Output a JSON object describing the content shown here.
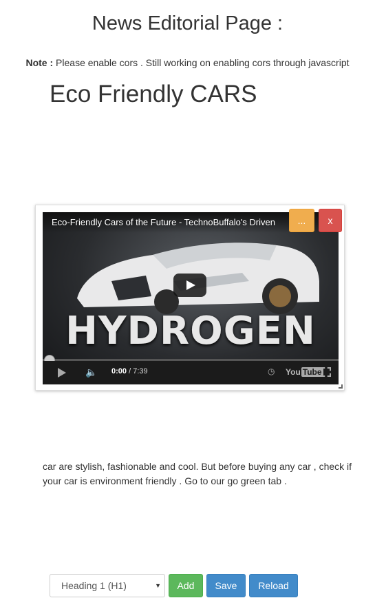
{
  "page": {
    "title": "News Editorial Page :",
    "note_label": "Note :",
    "note_text": " Please enable cors . Still working on enabling cors through javascript"
  },
  "article": {
    "title": "Eco Friendly CARS",
    "body": "car are stylish, fashionable and cool. But before buying any car , check if your car is environment friendly . Go to our go green tab ."
  },
  "video": {
    "title": "Eco-Friendly Cars of the Future - TechnoBuffalo's Driven",
    "overlay_text": "HYDROGEN",
    "more_label": "...",
    "close_label": "x",
    "current_time": "0:00",
    "duration": " / 7:39",
    "youtube_label": "You",
    "youtube_label_box": "Tube",
    "progress": 0
  },
  "toolbar": {
    "format_select_value": "Heading 1 (H1)",
    "add_label": "Add",
    "save_label": "Save",
    "reload_label": "Reload"
  },
  "colors": {
    "success": "#5cb85c",
    "primary": "#428bca",
    "warning": "#f0ad4e",
    "danger": "#d9534f"
  }
}
